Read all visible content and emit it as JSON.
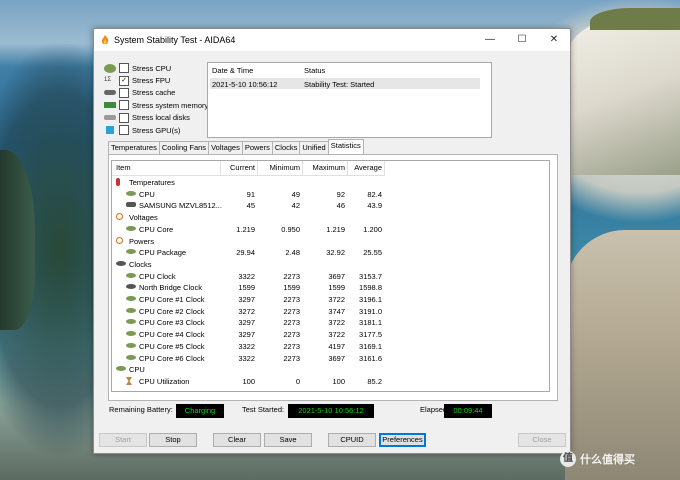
{
  "window": {
    "title": "System Stability Test - AIDA64"
  },
  "stress": [
    {
      "label": "Stress CPU",
      "checked": false,
      "icon": "cpu-icon"
    },
    {
      "label": "Stress FPU",
      "checked": true,
      "icon": "fpu-icon"
    },
    {
      "label": "Stress cache",
      "checked": false,
      "icon": "cache-icon"
    },
    {
      "label": "Stress system memory",
      "checked": false,
      "icon": "memory-icon"
    },
    {
      "label": "Stress local disks",
      "checked": false,
      "icon": "disk-icon"
    },
    {
      "label": "Stress GPU(s)",
      "checked": false,
      "icon": "gpu-icon"
    }
  ],
  "status_log": {
    "headers": [
      "Date & Time",
      "Status"
    ],
    "rows": [
      {
        "datetime": "2021-5-10 10:56:12",
        "status": "Stability Test: Started"
      }
    ]
  },
  "tabs": [
    "Temperatures",
    "Cooling Fans",
    "Voltages",
    "Powers",
    "Clocks",
    "Unified",
    "Statistics"
  ],
  "active_tab": "Statistics",
  "stats": {
    "headers": {
      "item": "Item",
      "current": "Current",
      "minimum": "Minimum",
      "maximum": "Maximum",
      "average": "Average"
    },
    "rows": [
      {
        "kind": "group",
        "icon": "thermometer-icon",
        "label": "Temperatures"
      },
      {
        "kind": "item",
        "icon": "leaf-icon",
        "label": "CPU",
        "current": "91",
        "minimum": "49",
        "maximum": "92",
        "average": "82.4"
      },
      {
        "kind": "item",
        "icon": "disk-icon",
        "label": "SAMSUNG MZVL8512...",
        "current": "45",
        "minimum": "42",
        "maximum": "46",
        "average": "43.9"
      },
      {
        "kind": "group",
        "icon": "voltage-icon",
        "label": "Voltages"
      },
      {
        "kind": "item",
        "icon": "leaf-icon",
        "label": "CPU Core",
        "current": "1.219",
        "minimum": "0.950",
        "maximum": "1.219",
        "average": "1.200"
      },
      {
        "kind": "group",
        "icon": "power-icon",
        "label": "Powers"
      },
      {
        "kind": "item",
        "icon": "leaf-icon",
        "label": "CPU Package",
        "current": "29.94",
        "minimum": "2.48",
        "maximum": "32.92",
        "average": "25.55"
      },
      {
        "kind": "group",
        "icon": "clock-icon",
        "label": "Clocks"
      },
      {
        "kind": "item",
        "icon": "leaf-icon",
        "label": "CPU Clock",
        "current": "3322",
        "minimum": "2273",
        "maximum": "3697",
        "average": "3153.7"
      },
      {
        "kind": "item",
        "icon": "chip-icon",
        "label": "North Bridge Clock",
        "current": "1599",
        "minimum": "1599",
        "maximum": "1599",
        "average": "1598.8"
      },
      {
        "kind": "item",
        "icon": "leaf-icon",
        "label": "CPU Core #1 Clock",
        "current": "3297",
        "minimum": "2273",
        "maximum": "3722",
        "average": "3196.1"
      },
      {
        "kind": "item",
        "icon": "leaf-icon",
        "label": "CPU Core #2 Clock",
        "current": "3272",
        "minimum": "2273",
        "maximum": "3747",
        "average": "3191.0"
      },
      {
        "kind": "item",
        "icon": "leaf-icon",
        "label": "CPU Core #3 Clock",
        "current": "3297",
        "minimum": "2273",
        "maximum": "3722",
        "average": "3181.1"
      },
      {
        "kind": "item",
        "icon": "leaf-icon",
        "label": "CPU Core #4 Clock",
        "current": "3297",
        "minimum": "2273",
        "maximum": "3722",
        "average": "3177.5"
      },
      {
        "kind": "item",
        "icon": "leaf-icon",
        "label": "CPU Core #5 Clock",
        "current": "3322",
        "minimum": "2273",
        "maximum": "4197",
        "average": "3169.1"
      },
      {
        "kind": "item",
        "icon": "leaf-icon",
        "label": "CPU Core #6 Clock",
        "current": "3322",
        "minimum": "2273",
        "maximum": "3697",
        "average": "3161.6"
      },
      {
        "kind": "group",
        "icon": "cpu-group-icon",
        "label": "CPU"
      },
      {
        "kind": "item",
        "icon": "hourglass-icon",
        "label": "CPU Utilization",
        "current": "100",
        "minimum": "0",
        "maximum": "100",
        "average": "85.2"
      }
    ]
  },
  "bottom": {
    "battery_label": "Remaining Battery:",
    "battery_value": "Charging",
    "started_label": "Test Started:",
    "started_value": "2021-5-10 10:56:12",
    "elapsed_label": "Elapsed Time:",
    "elapsed_value": "00:09:44"
  },
  "buttons": {
    "start": "Start",
    "stop": "Stop",
    "clear": "Clear",
    "save": "Save",
    "cpuid": "CPUID",
    "preferences": "Preferences",
    "close": "Close"
  },
  "watermark": {
    "text": "什么值得买",
    "badge": "值"
  },
  "colors": {
    "lcd_text": "#18d018",
    "lcd_bg": "#000000",
    "focus": "#0078d7"
  }
}
